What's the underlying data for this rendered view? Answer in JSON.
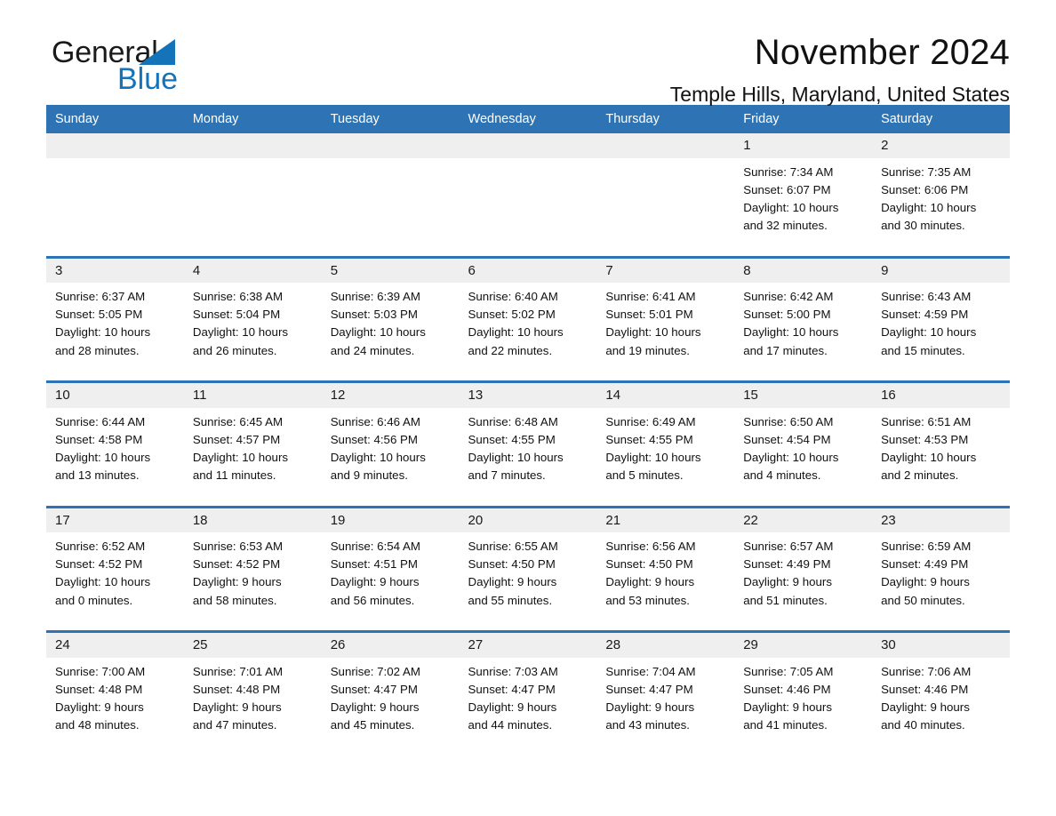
{
  "brand": {
    "name_part1": "General",
    "name_part2": "Blue",
    "triangle_color": "#1573b9"
  },
  "header": {
    "title": "November 2024",
    "subtitle": "Temple Hills, Maryland, United States",
    "header_bg_color": "#2e74b5",
    "daynum_bg_color": "#efefef"
  },
  "weekday_headers": [
    "Sunday",
    "Monday",
    "Tuesday",
    "Wednesday",
    "Thursday",
    "Friday",
    "Saturday"
  ],
  "weeks": [
    {
      "days": [
        {
          "num": "",
          "l1": "",
          "l2": "",
          "l3": "",
          "l4": ""
        },
        {
          "num": "",
          "l1": "",
          "l2": "",
          "l3": "",
          "l4": ""
        },
        {
          "num": "",
          "l1": "",
          "l2": "",
          "l3": "",
          "l4": ""
        },
        {
          "num": "",
          "l1": "",
          "l2": "",
          "l3": "",
          "l4": ""
        },
        {
          "num": "",
          "l1": "",
          "l2": "",
          "l3": "",
          "l4": ""
        },
        {
          "num": "1",
          "l1": "Sunrise: 7:34 AM",
          "l2": "Sunset: 6:07 PM",
          "l3": "Daylight: 10 hours",
          "l4": "and 32 minutes."
        },
        {
          "num": "2",
          "l1": "Sunrise: 7:35 AM",
          "l2": "Sunset: 6:06 PM",
          "l3": "Daylight: 10 hours",
          "l4": "and 30 minutes."
        }
      ]
    },
    {
      "days": [
        {
          "num": "3",
          "l1": "Sunrise: 6:37 AM",
          "l2": "Sunset: 5:05 PM",
          "l3": "Daylight: 10 hours",
          "l4": "and 28 minutes."
        },
        {
          "num": "4",
          "l1": "Sunrise: 6:38 AM",
          "l2": "Sunset: 5:04 PM",
          "l3": "Daylight: 10 hours",
          "l4": "and 26 minutes."
        },
        {
          "num": "5",
          "l1": "Sunrise: 6:39 AM",
          "l2": "Sunset: 5:03 PM",
          "l3": "Daylight: 10 hours",
          "l4": "and 24 minutes."
        },
        {
          "num": "6",
          "l1": "Sunrise: 6:40 AM",
          "l2": "Sunset: 5:02 PM",
          "l3": "Daylight: 10 hours",
          "l4": "and 22 minutes."
        },
        {
          "num": "7",
          "l1": "Sunrise: 6:41 AM",
          "l2": "Sunset: 5:01 PM",
          "l3": "Daylight: 10 hours",
          "l4": "and 19 minutes."
        },
        {
          "num": "8",
          "l1": "Sunrise: 6:42 AM",
          "l2": "Sunset: 5:00 PM",
          "l3": "Daylight: 10 hours",
          "l4": "and 17 minutes."
        },
        {
          "num": "9",
          "l1": "Sunrise: 6:43 AM",
          "l2": "Sunset: 4:59 PM",
          "l3": "Daylight: 10 hours",
          "l4": "and 15 minutes."
        }
      ]
    },
    {
      "days": [
        {
          "num": "10",
          "l1": "Sunrise: 6:44 AM",
          "l2": "Sunset: 4:58 PM",
          "l3": "Daylight: 10 hours",
          "l4": "and 13 minutes."
        },
        {
          "num": "11",
          "l1": "Sunrise: 6:45 AM",
          "l2": "Sunset: 4:57 PM",
          "l3": "Daylight: 10 hours",
          "l4": "and 11 minutes."
        },
        {
          "num": "12",
          "l1": "Sunrise: 6:46 AM",
          "l2": "Sunset: 4:56 PM",
          "l3": "Daylight: 10 hours",
          "l4": "and 9 minutes."
        },
        {
          "num": "13",
          "l1": "Sunrise: 6:48 AM",
          "l2": "Sunset: 4:55 PM",
          "l3": "Daylight: 10 hours",
          "l4": "and 7 minutes."
        },
        {
          "num": "14",
          "l1": "Sunrise: 6:49 AM",
          "l2": "Sunset: 4:55 PM",
          "l3": "Daylight: 10 hours",
          "l4": "and 5 minutes."
        },
        {
          "num": "15",
          "l1": "Sunrise: 6:50 AM",
          "l2": "Sunset: 4:54 PM",
          "l3": "Daylight: 10 hours",
          "l4": "and 4 minutes."
        },
        {
          "num": "16",
          "l1": "Sunrise: 6:51 AM",
          "l2": "Sunset: 4:53 PM",
          "l3": "Daylight: 10 hours",
          "l4": "and 2 minutes."
        }
      ]
    },
    {
      "days": [
        {
          "num": "17",
          "l1": "Sunrise: 6:52 AM",
          "l2": "Sunset: 4:52 PM",
          "l3": "Daylight: 10 hours",
          "l4": "and 0 minutes."
        },
        {
          "num": "18",
          "l1": "Sunrise: 6:53 AM",
          "l2": "Sunset: 4:52 PM",
          "l3": "Daylight: 9 hours",
          "l4": "and 58 minutes."
        },
        {
          "num": "19",
          "l1": "Sunrise: 6:54 AM",
          "l2": "Sunset: 4:51 PM",
          "l3": "Daylight: 9 hours",
          "l4": "and 56 minutes."
        },
        {
          "num": "20",
          "l1": "Sunrise: 6:55 AM",
          "l2": "Sunset: 4:50 PM",
          "l3": "Daylight: 9 hours",
          "l4": "and 55 minutes."
        },
        {
          "num": "21",
          "l1": "Sunrise: 6:56 AM",
          "l2": "Sunset: 4:50 PM",
          "l3": "Daylight: 9 hours",
          "l4": "and 53 minutes."
        },
        {
          "num": "22",
          "l1": "Sunrise: 6:57 AM",
          "l2": "Sunset: 4:49 PM",
          "l3": "Daylight: 9 hours",
          "l4": "and 51 minutes."
        },
        {
          "num": "23",
          "l1": "Sunrise: 6:59 AM",
          "l2": "Sunset: 4:49 PM",
          "l3": "Daylight: 9 hours",
          "l4": "and 50 minutes."
        }
      ]
    },
    {
      "days": [
        {
          "num": "24",
          "l1": "Sunrise: 7:00 AM",
          "l2": "Sunset: 4:48 PM",
          "l3": "Daylight: 9 hours",
          "l4": "and 48 minutes."
        },
        {
          "num": "25",
          "l1": "Sunrise: 7:01 AM",
          "l2": "Sunset: 4:48 PM",
          "l3": "Daylight: 9 hours",
          "l4": "and 47 minutes."
        },
        {
          "num": "26",
          "l1": "Sunrise: 7:02 AM",
          "l2": "Sunset: 4:47 PM",
          "l3": "Daylight: 9 hours",
          "l4": "and 45 minutes."
        },
        {
          "num": "27",
          "l1": "Sunrise: 7:03 AM",
          "l2": "Sunset: 4:47 PM",
          "l3": "Daylight: 9 hours",
          "l4": "and 44 minutes."
        },
        {
          "num": "28",
          "l1": "Sunrise: 7:04 AM",
          "l2": "Sunset: 4:47 PM",
          "l3": "Daylight: 9 hours",
          "l4": "and 43 minutes."
        },
        {
          "num": "29",
          "l1": "Sunrise: 7:05 AM",
          "l2": "Sunset: 4:46 PM",
          "l3": "Daylight: 9 hours",
          "l4": "and 41 minutes."
        },
        {
          "num": "30",
          "l1": "Sunrise: 7:06 AM",
          "l2": "Sunset: 4:46 PM",
          "l3": "Daylight: 9 hours",
          "l4": "and 40 minutes."
        }
      ]
    }
  ]
}
